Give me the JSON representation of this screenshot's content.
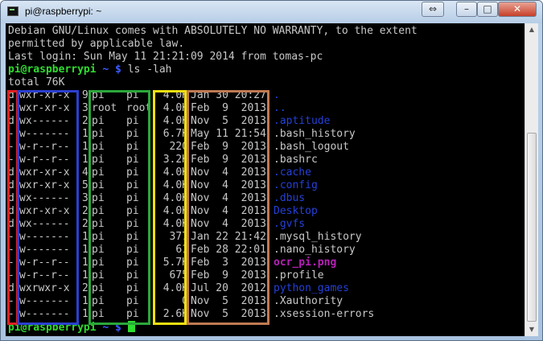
{
  "window": {
    "title": "pi@raspberrypi: ~",
    "controls": {
      "restore_left": "⇔",
      "minimize": "–",
      "maximize": "□",
      "close": "✕"
    }
  },
  "terminal": {
    "motd_lines": [
      "Debian GNU/Linux comes with ABSOLUTELY NO WARRANTY, to the extent",
      "permitted by applicable law.",
      "Last login: Sun May 11 21:21:09 2014 from tomas-pc"
    ],
    "prompt_user_host": "pi@raspberrypi",
    "prompt_path": " ~ $",
    "command": " ls -lah",
    "total_line": "total 76K",
    "listing": [
      {
        "type": "d",
        "perms": "wxr-xr-x",
        "links": "9",
        "owner": "pi",
        "group": "pi",
        "size": "4.0K",
        "date": "Jan 30 20:27",
        "name": ".",
        "kind": "dir"
      },
      {
        "type": "d",
        "perms": "wxr-xr-x",
        "links": "3",
        "owner": "root",
        "group": "root",
        "size": "4.0K",
        "date": "Feb  9  2013",
        "name": "..",
        "kind": "dir"
      },
      {
        "type": "d",
        "perms": "wx------",
        "links": "2",
        "owner": "pi",
        "group": "pi",
        "size": "4.0K",
        "date": "Nov  5  2013",
        "name": ".aptitude",
        "kind": "dir"
      },
      {
        "type": "-",
        "perms": "w-------",
        "links": "1",
        "owner": "pi",
        "group": "pi",
        "size": "6.7K",
        "date": "May 11 21:54",
        "name": ".bash_history",
        "kind": "file"
      },
      {
        "type": "-",
        "perms": "w-r--r--",
        "links": "1",
        "owner": "pi",
        "group": "pi",
        "size": "220",
        "date": "Feb  9  2013",
        "name": ".bash_logout",
        "kind": "file"
      },
      {
        "type": "-",
        "perms": "w-r--r--",
        "links": "1",
        "owner": "pi",
        "group": "pi",
        "size": "3.2K",
        "date": "Feb  9  2013",
        "name": ".bashrc",
        "kind": "file"
      },
      {
        "type": "d",
        "perms": "wxr-xr-x",
        "links": "4",
        "owner": "pi",
        "group": "pi",
        "size": "4.0K",
        "date": "Nov  4  2013",
        "name": ".cache",
        "kind": "dir"
      },
      {
        "type": "d",
        "perms": "wxr-xr-x",
        "links": "5",
        "owner": "pi",
        "group": "pi",
        "size": "4.0K",
        "date": "Nov  4  2013",
        "name": ".config",
        "kind": "dir"
      },
      {
        "type": "d",
        "perms": "wx------",
        "links": "3",
        "owner": "pi",
        "group": "pi",
        "size": "4.0K",
        "date": "Nov  4  2013",
        "name": ".dbus",
        "kind": "dir"
      },
      {
        "type": "d",
        "perms": "wxr-xr-x",
        "links": "2",
        "owner": "pi",
        "group": "pi",
        "size": "4.0K",
        "date": "Nov  4  2013",
        "name": "Desktop",
        "kind": "dir"
      },
      {
        "type": "d",
        "perms": "wx------",
        "links": "2",
        "owner": "pi",
        "group": "pi",
        "size": "4.0K",
        "date": "Nov  4  2013",
        "name": ".gvfs",
        "kind": "dir"
      },
      {
        "type": "-",
        "perms": "w-------",
        "links": "1",
        "owner": "pi",
        "group": "pi",
        "size": "377",
        "date": "Jan 22 21:42",
        "name": ".mysql_history",
        "kind": "file"
      },
      {
        "type": "-",
        "perms": "w-------",
        "links": "1",
        "owner": "pi",
        "group": "pi",
        "size": "61",
        "date": "Feb 28 22:01",
        "name": ".nano_history",
        "kind": "file"
      },
      {
        "type": "-",
        "perms": "w-r--r--",
        "links": "1",
        "owner": "pi",
        "group": "pi",
        "size": "5.7K",
        "date": "Feb  3  2013",
        "name": "ocr_pi.png",
        "kind": "image"
      },
      {
        "type": "-",
        "perms": "w-r--r--",
        "links": "1",
        "owner": "pi",
        "group": "pi",
        "size": "675",
        "date": "Feb  9  2013",
        "name": ".profile",
        "kind": "file"
      },
      {
        "type": "d",
        "perms": "wxrwxr-x",
        "links": "2",
        "owner": "pi",
        "group": "pi",
        "size": "4.0K",
        "date": "Jul 20  2012",
        "name": "python_games",
        "kind": "dir"
      },
      {
        "type": "-",
        "perms": "w-------",
        "links": "1",
        "owner": "pi",
        "group": "pi",
        "size": "0",
        "date": "Nov  5  2013",
        "name": ".Xauthority",
        "kind": "file"
      },
      {
        "type": "-",
        "perms": "w-------",
        "links": "1",
        "owner": "pi",
        "group": "pi",
        "size": "2.6K",
        "date": "Nov  5  2013",
        "name": ".xsession-errors",
        "kind": "file"
      }
    ],
    "colors": {
      "background": "#000000",
      "text": "#c8c8c8",
      "prompt_user": "#2fdc2f",
      "prompt_path": "#3b5bff",
      "directory": "#2540d8",
      "image": "#b81fb8"
    },
    "highlight_colors": {
      "type_column": "#e02020",
      "permissions_column": "#2b3fd0",
      "owner_group_column": "#2aa83a",
      "size_column": "#f0e010",
      "date_column": "#c07a52"
    }
  }
}
